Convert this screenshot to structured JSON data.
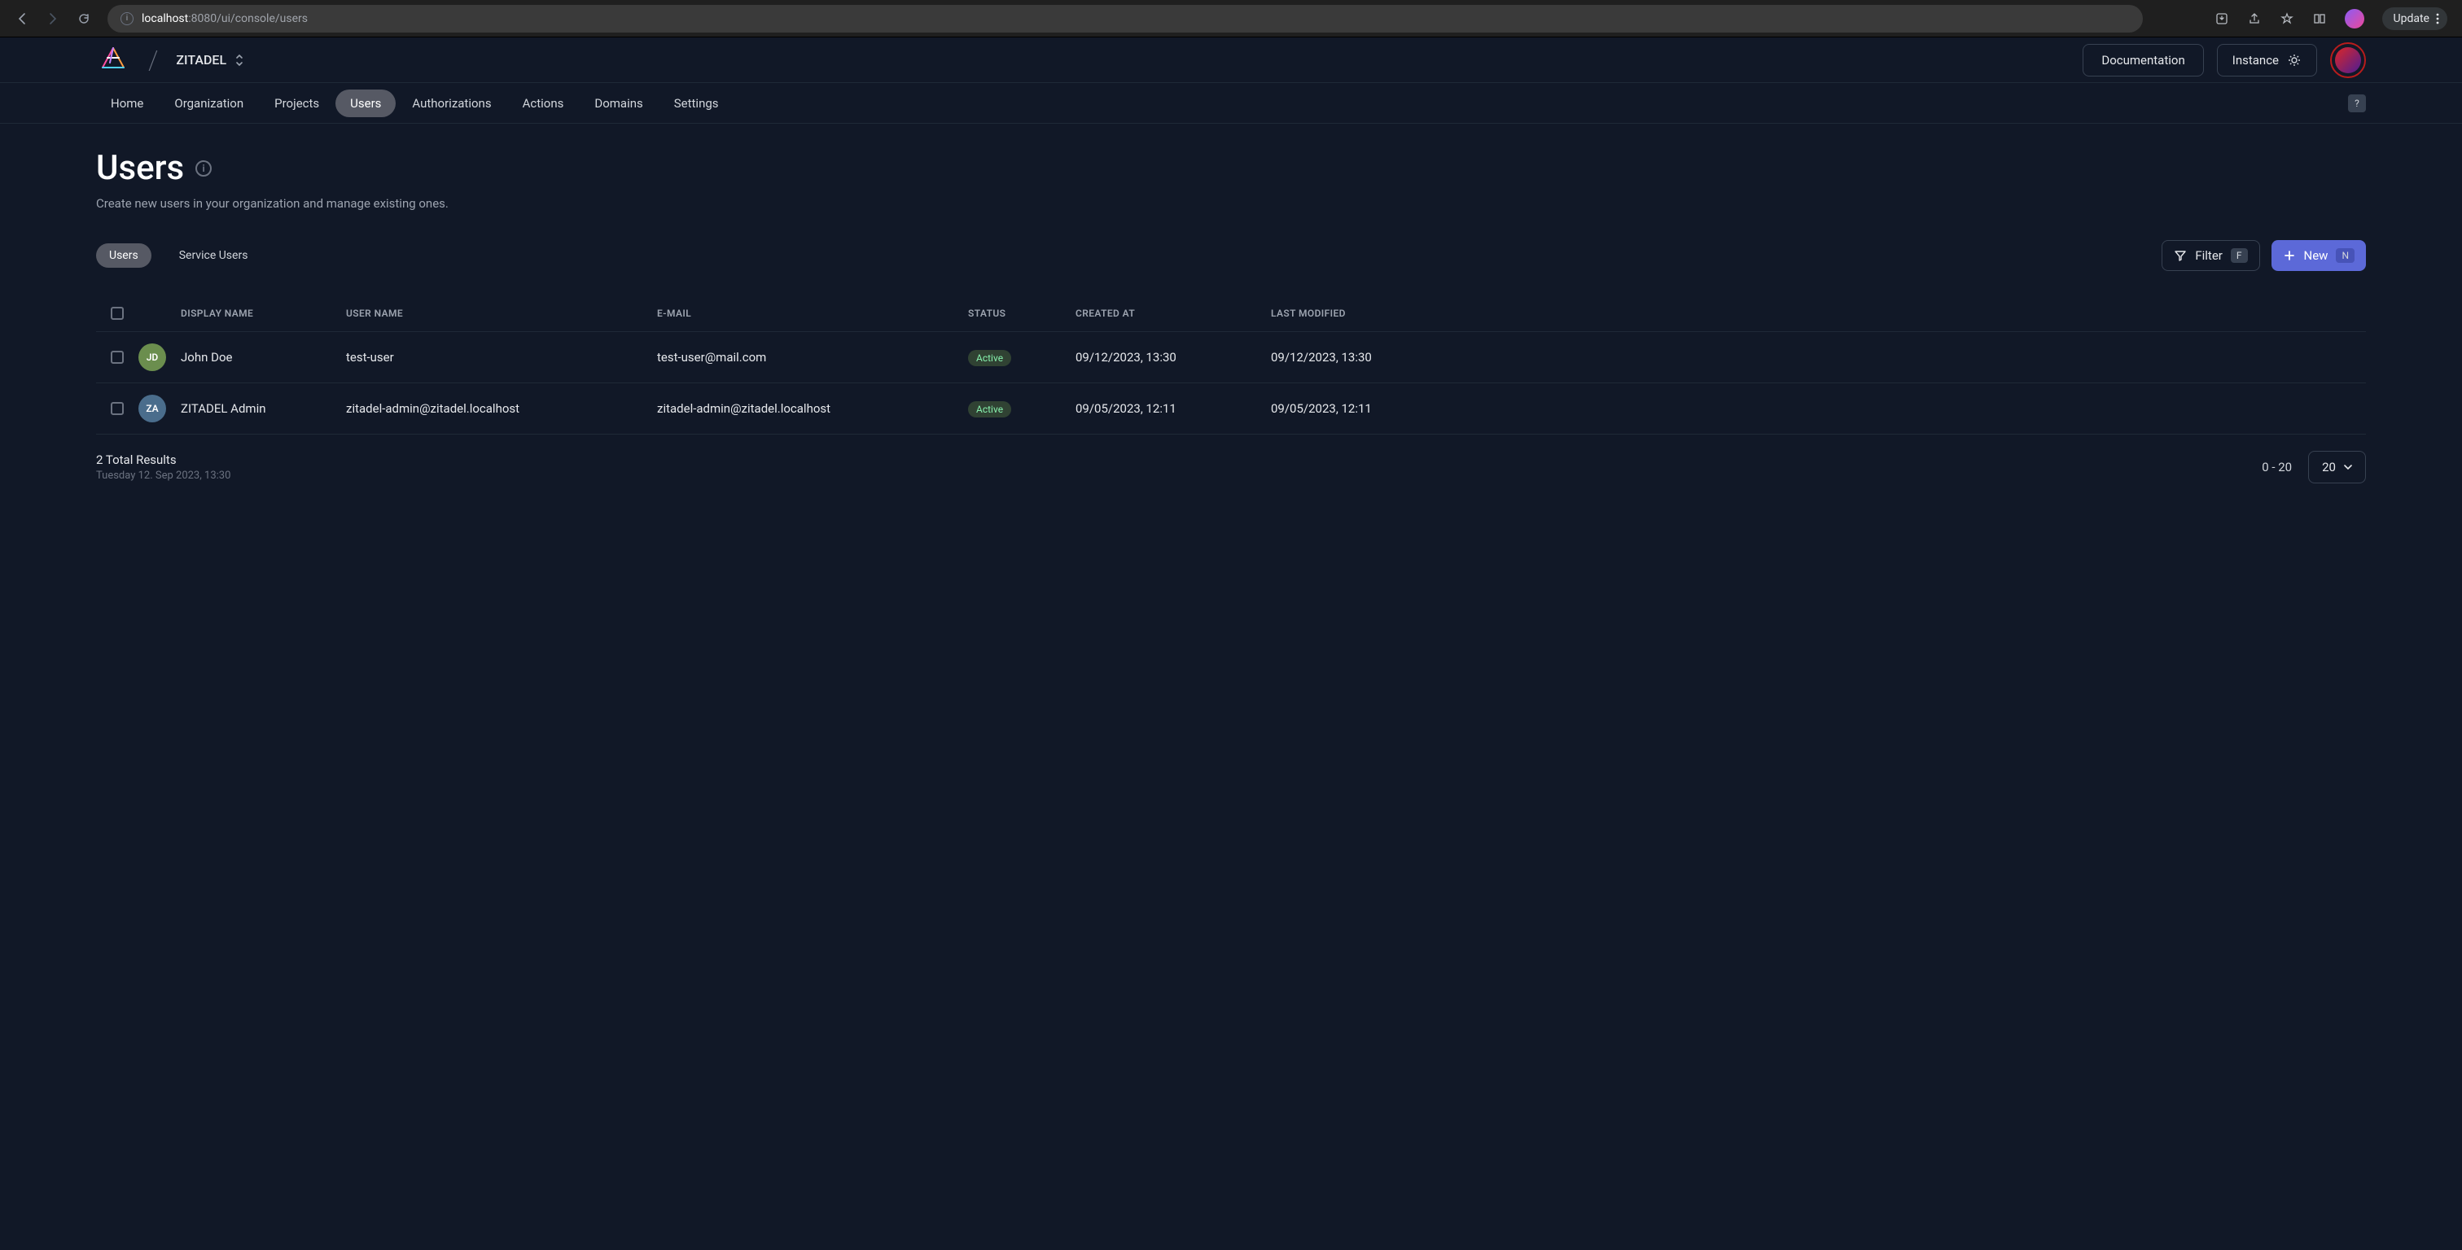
{
  "browser": {
    "url_host": "localhost",
    "url_path": ":8080/ui/console/users",
    "update_label": "Update"
  },
  "header": {
    "org_name": "ZITADEL",
    "documentation_label": "Documentation",
    "instance_label": "Instance"
  },
  "nav": {
    "items": [
      {
        "label": "Home"
      },
      {
        "label": "Organization"
      },
      {
        "label": "Projects"
      },
      {
        "label": "Users"
      },
      {
        "label": "Authorizations"
      },
      {
        "label": "Actions"
      },
      {
        "label": "Domains"
      },
      {
        "label": "Settings"
      }
    ],
    "active_index": 3,
    "help_key": "?"
  },
  "page": {
    "title": "Users",
    "subtitle": "Create new users in your organization and manage existing ones."
  },
  "tabs": {
    "items": [
      {
        "label": "Users"
      },
      {
        "label": "Service Users"
      }
    ],
    "active_index": 0
  },
  "actions": {
    "filter_label": "Filter",
    "filter_key": "F",
    "new_label": "New",
    "new_key": "N"
  },
  "table": {
    "columns": {
      "display": "DISPLAY NAME",
      "user": "USER NAME",
      "email": "E-MAIL",
      "status": "STATUS",
      "created": "CREATED AT",
      "modified": "LAST MODIFIED"
    },
    "rows": [
      {
        "initials": "JD",
        "initials_class": "av-jd",
        "display": "John Doe",
        "user": "test-user",
        "email": "test-user@mail.com",
        "status": "Active",
        "created": "09/12/2023, 13:30",
        "modified": "09/12/2023, 13:30"
      },
      {
        "initials": "ZA",
        "initials_class": "av-za",
        "display": "ZITADEL Admin",
        "user": "zitadel-admin@zitadel.localhost",
        "email": "zitadel-admin@zitadel.localhost",
        "status": "Active",
        "created": "09/05/2023, 12:11",
        "modified": "09/05/2023, 12:11"
      }
    ]
  },
  "footer": {
    "results": "2 Total Results",
    "timestamp": "Tuesday 12. Sep 2023, 13:30",
    "range": "0 - 20",
    "pagesize": "20"
  }
}
